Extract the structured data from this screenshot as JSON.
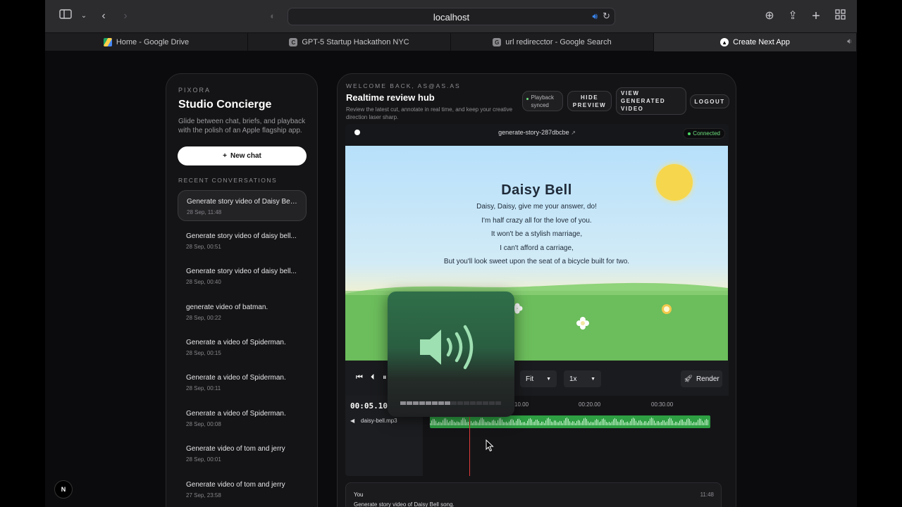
{
  "browser": {
    "url": "localhost",
    "tabs": [
      {
        "label": "Home - Google Drive",
        "icon": "google-drive-icon",
        "active": false
      },
      {
        "label": "GPT-5 Startup Hackathon NYC",
        "icon": "C",
        "active": false
      },
      {
        "label": "url redirecctor - Google Search",
        "icon": "G",
        "active": false
      },
      {
        "label": "Create Next App",
        "icon": "nextjs-icon",
        "active": true
      }
    ]
  },
  "sidebar": {
    "brand": "PIXORA",
    "title": "Studio Concierge",
    "subtitle": "Glide between chat, briefs, and playback with the polish of an Apple flagship app.",
    "new_chat_label": "New chat",
    "recent_heading": "RECENT CONVERSATIONS",
    "conversations": [
      {
        "title": "Generate story video of Daisy Bel...",
        "date": "28 Sep, 11:48",
        "selected": true
      },
      {
        "title": "Generate story video of daisy bell...",
        "date": "28 Sep, 00:51"
      },
      {
        "title": "Generate story video of daisy bell...",
        "date": "28 Sep, 00:40"
      },
      {
        "title": "generate video of batman.",
        "date": "28 Sep, 00:22"
      },
      {
        "title": "Generate a video of Spiderman.",
        "date": "28 Sep, 00:15"
      },
      {
        "title": "Generate a video of Spiderman.",
        "date": "28 Sep, 00:11"
      },
      {
        "title": "Generate a video of Spiderman.",
        "date": "28 Sep, 00:08"
      },
      {
        "title": "Generate video of tom and jerry",
        "date": "28 Sep, 00:01"
      },
      {
        "title": "Generate video of tom and jerry",
        "date": "27 Sep, 23:58"
      }
    ]
  },
  "main": {
    "welcome": "WELCOME BACK, AS@AS.AS",
    "title": "Realtime review hub",
    "subtitle": "Review the latest cut, annotate in real time, and keep your creative direction laser sharp.",
    "playback_status": "Playback synced",
    "hide_preview_label": "HIDE PREVIEW",
    "view_generated_label": "VIEW GENERATED VIDEO",
    "logout_label": "LOGOUT"
  },
  "player": {
    "file_name": "generate-story-287dbcbe",
    "connection_status": "Connected",
    "song_title": "Daisy Bell",
    "lyrics": [
      "Daisy, Daisy, give me your answer, do!",
      "I'm half crazy all for the love of you.",
      "It won't be a stylish marriage,",
      "I can't afford a carriage,",
      "But you'll look sweet upon the seat of a bicycle built for two."
    ],
    "fit_option": "Fit",
    "speed_option": "1x",
    "render_label": "Render",
    "timecode": "00:05.10",
    "ticks": [
      "10.00",
      "00:20.00",
      "00:30.00"
    ],
    "audio_track_name": "daisy-bell.mp3",
    "volume_level": 0.5
  },
  "chat_preview": {
    "author": "You",
    "time": "11:48",
    "message": "Generate story video of Daisy Bell song."
  },
  "nextjs_badge": "N",
  "colors": {
    "accent_green": "#2ea043",
    "connected_green": "#4cd964",
    "playhead_red": "#e03a3a",
    "sun_yellow": "#f6d64d"
  }
}
